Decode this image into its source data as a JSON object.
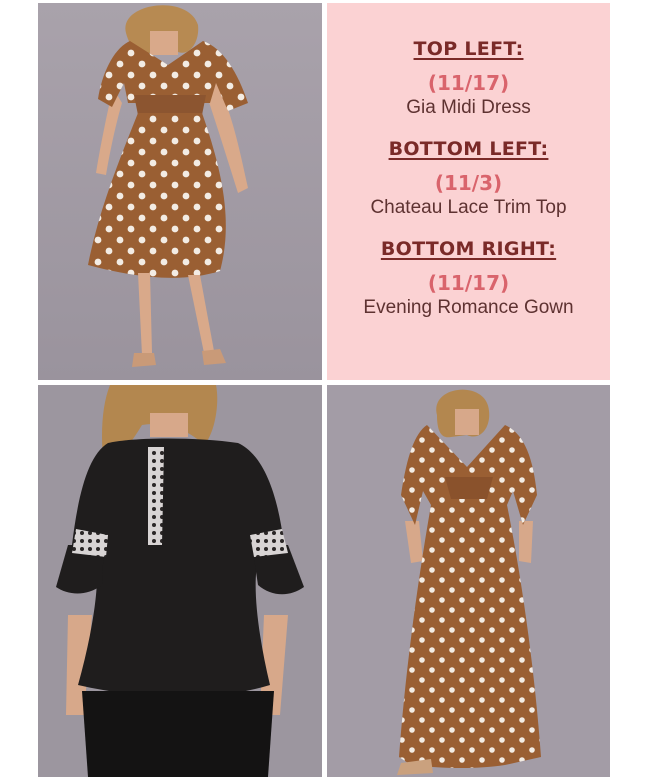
{
  "collage": {
    "top_left_image": {
      "alt": "Gia Midi Dress",
      "icon": "polka-dot-midi-dress-photo"
    },
    "bottom_left_image": {
      "alt": "Chateau Lace Trim Top",
      "icon": "black-lace-trim-top-photo"
    },
    "bottom_right_image": {
      "alt": "Evening Romance Gown",
      "icon": "polka-dot-gown-photo"
    }
  },
  "info": {
    "sections": [
      {
        "heading": "TOP LEFT:",
        "date": "(11/17)",
        "name": "Gia Midi Dress"
      },
      {
        "heading": "BOTTOM LEFT:",
        "date": "(11/3)",
        "name": "Chateau Lace Trim Top"
      },
      {
        "heading": "BOTTOM RIGHT:",
        "date": "(11/17)",
        "name": "Evening Romance Gown"
      }
    ]
  },
  "colors": {
    "panel_bg": "#fbd2d3",
    "heading": "#7a2a28",
    "date": "#d9646c",
    "fabric_brown": "#9a5f33",
    "photo_bg": "#a59ea7"
  }
}
